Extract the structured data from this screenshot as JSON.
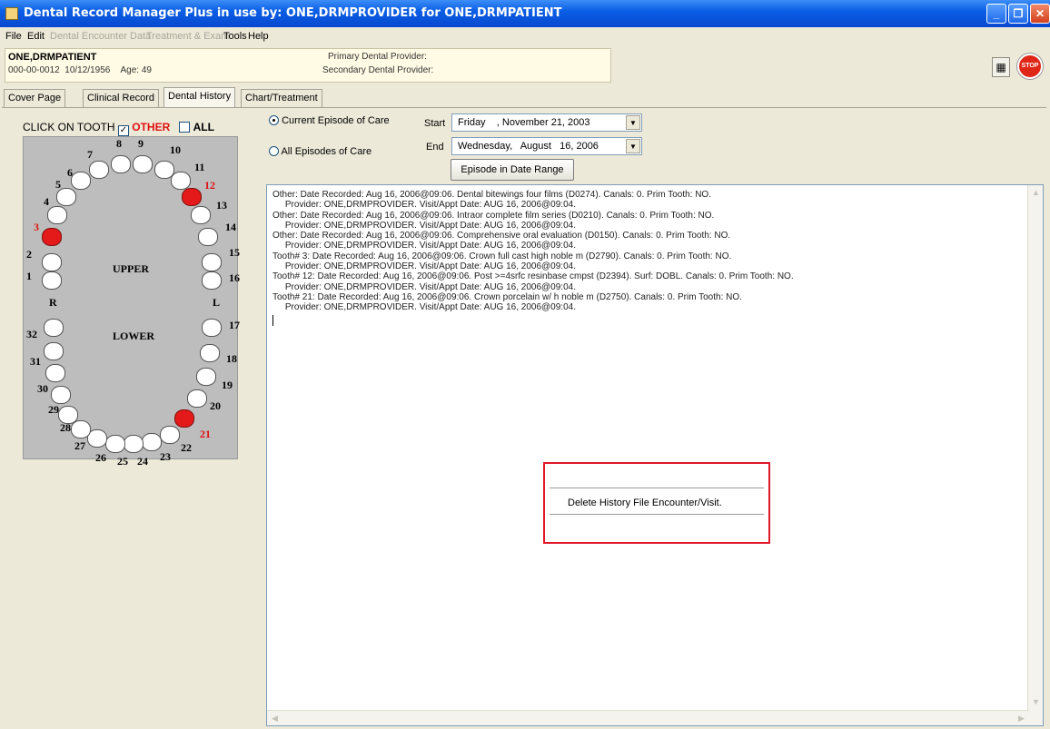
{
  "window": {
    "title": "Dental Record Manager Plus in use by: ONE,DRMPROVIDER for ONE,DRMPATIENT",
    "minimize": "_",
    "maximize": "❐",
    "close": "✕"
  },
  "menu": {
    "file": "File",
    "edit": "Edit",
    "dental_encounter_data": "Dental Encounter Data",
    "treatment_exam": "Treatment & Exam",
    "tools": "Tools",
    "help": "Help"
  },
  "patient": {
    "name": "ONE,DRMPATIENT",
    "ssn": "000-00-0012",
    "dob": "10/12/1956",
    "age_label": "Age: 49",
    "primary_provider_label": "Primary Dental Provider:",
    "secondary_provider_label": "Secondary Dental Provider:"
  },
  "toolbar": {
    "stop_label": "STOP",
    "calc_icon": "calculator-icon"
  },
  "tabs": [
    "Cover Page",
    "Clinical Record",
    "Dental History",
    "Chart/Treatment"
  ],
  "active_tab": "Dental History",
  "left_panel": {
    "click_on_tooth": "CLICK ON TOOTH",
    "other_label": "OTHER",
    "other_checked": true,
    "all_label": "ALL",
    "all_checked": false,
    "upper_label": "UPPER",
    "lower_label": "LOWER",
    "right_label": "R",
    "left_label": "L",
    "highlighted_teeth": [
      "3",
      "12",
      "21"
    ],
    "highlight_color": "#e41a1a",
    "teeth": [
      {
        "n": "1"
      },
      {
        "n": "2"
      },
      {
        "n": "3"
      },
      {
        "n": "4"
      },
      {
        "n": "5"
      },
      {
        "n": "6"
      },
      {
        "n": "7"
      },
      {
        "n": "8"
      },
      {
        "n": "9"
      },
      {
        "n": "10"
      },
      {
        "n": "11"
      },
      {
        "n": "12"
      },
      {
        "n": "13"
      },
      {
        "n": "14"
      },
      {
        "n": "15"
      },
      {
        "n": "16"
      },
      {
        "n": "17"
      },
      {
        "n": "18"
      },
      {
        "n": "19"
      },
      {
        "n": "20"
      },
      {
        "n": "21"
      },
      {
        "n": "22"
      },
      {
        "n": "23"
      },
      {
        "n": "24"
      },
      {
        "n": "25"
      },
      {
        "n": "26"
      },
      {
        "n": "27"
      },
      {
        "n": "28"
      },
      {
        "n": "29"
      },
      {
        "n": "30"
      },
      {
        "n": "31"
      },
      {
        "n": "32"
      }
    ]
  },
  "episode": {
    "current_label": "Current Episode of Care",
    "all_label": "All Episodes of Care",
    "selected": "current",
    "start_label": "Start",
    "start_value": "Friday    , November 21, 2003",
    "end_label": "End",
    "end_value": "Wednesday,   August   16, 2006",
    "range_button": "Episode in Date Range"
  },
  "history": {
    "lines": [
      "Other: Date Recorded: Aug 16, 2006@09:06. Dental bitewings four films (D0274). Canals: 0. Prim Tooth: NO.",
      "     Provider: ONE,DRMPROVIDER. Visit/Appt Date: AUG 16, 2006@09:04.",
      "Other: Date Recorded: Aug 16, 2006@09:06. Intraor complete film series (D0210). Canals: 0. Prim Tooth: NO.",
      "     Provider: ONE,DRMPROVIDER. Visit/Appt Date: AUG 16, 2006@09:04.",
      "Other: Date Recorded: Aug 16, 2006@09:06. Comprehensive oral evaluation (D0150). Canals: 0. Prim Tooth: NO.",
      "     Provider: ONE,DRMPROVIDER. Visit/Appt Date: AUG 16, 2006@09:04.",
      "Tooth# 3: Date Recorded: Aug 16, 2006@09:06. Crown full cast high noble m (D2790). Canals: 0. Prim Tooth: NO.",
      "     Provider: ONE,DRMPROVIDER. Visit/Appt Date: AUG 16, 2006@09:04.",
      "Tooth# 12: Date Recorded: Aug 16, 2006@09:06. Post >=4srfc resinbase cmpst (D2394). Surf: DOBL. Canals: 0. Prim Tooth: NO.",
      "     Provider: ONE,DRMPROVIDER. Visit/Appt Date: AUG 16, 2006@09:04.",
      "Tooth# 21: Date Recorded: Aug 16, 2006@09:06. Crown porcelain w/ h noble m (D2750). Canals: 0. Prim Tooth: NO.",
      "     Provider: ONE,DRMPROVIDER. Visit/Appt Date: AUG 16, 2006@09:04."
    ]
  },
  "context_menu": {
    "item": "Delete History File Encounter/Visit."
  }
}
